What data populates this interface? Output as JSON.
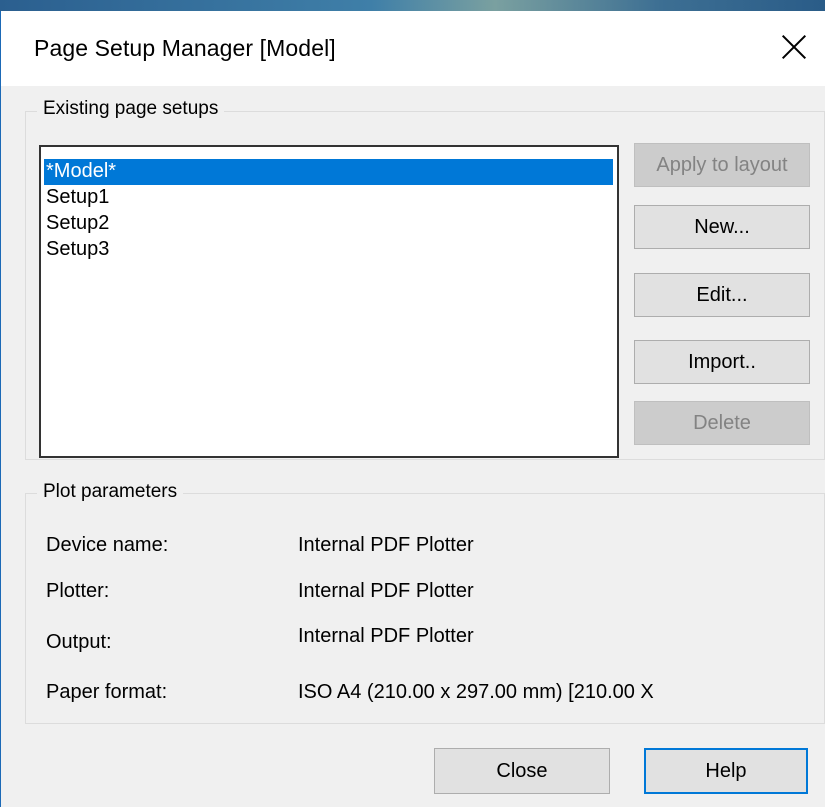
{
  "dialog": {
    "title": "Page Setup Manager [Model]"
  },
  "existing": {
    "legend": "Existing page setups",
    "items": [
      "*Model*",
      "Setup1",
      "Setup2",
      "Setup3"
    ],
    "selected_index": 0
  },
  "buttons": {
    "apply": "Apply to layout",
    "new": "New...",
    "edit": "Edit...",
    "import": "Import..",
    "delete": "Delete"
  },
  "plot": {
    "legend": "Plot parameters",
    "device_label": "Device name:",
    "device_value": "Internal PDF Plotter",
    "plotter_label": "Plotter:",
    "plotter_value": "Internal PDF Plotter",
    "output_label": "Output:",
    "output_value": "Internal PDF Plotter",
    "paper_label": "Paper format:",
    "paper_value": "ISO A4 (210.00 x 297.00 mm) [210.00 X"
  },
  "footer": {
    "close": "Close",
    "help": "Help"
  },
  "colors": {
    "selection": "#0078d7",
    "dialog_bg": "#f0f0f0",
    "window_border": "#1b69b6"
  },
  "icons": {
    "title_close": "close-icon"
  }
}
